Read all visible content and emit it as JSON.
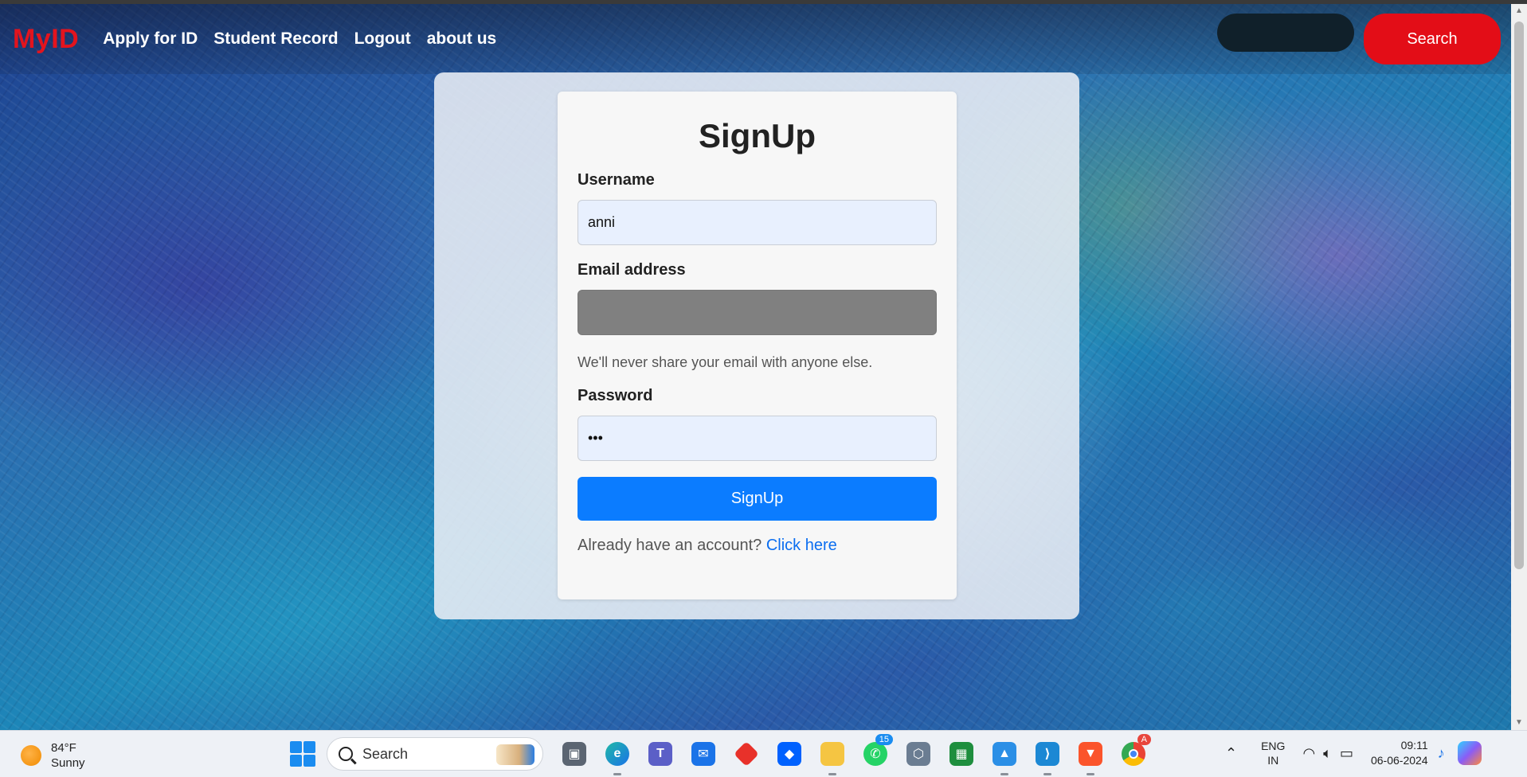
{
  "navbar": {
    "brand": "MyID",
    "links": [
      "Apply for ID",
      "Student Record",
      "Logout",
      "about us"
    ],
    "search_placeholder": "",
    "search_button": "Search"
  },
  "form": {
    "title": "SignUp",
    "username_label": "Username",
    "username_value": "anni",
    "email_label": "Email address",
    "email_value": "",
    "email_help": "We'll never share your email with anyone else.",
    "password_label": "Password",
    "password_value": "abc",
    "submit_label": "SignUp",
    "login_prompt": "Already have an account?",
    "login_link": "Click here"
  },
  "taskbar": {
    "weather_temp": "84°F",
    "weather_desc": "Sunny",
    "search_label": "Search",
    "whatsapp_badge": "15",
    "chrome_badge": "A",
    "lang_top": "ENG",
    "lang_bottom": "IN",
    "time": "09:11",
    "date": "06-06-2024"
  },
  "colors": {
    "brand": "#e3141e",
    "search_button": "#e30d17",
    "primary_button": "#0b7cff",
    "link": "#0b6ef0"
  }
}
